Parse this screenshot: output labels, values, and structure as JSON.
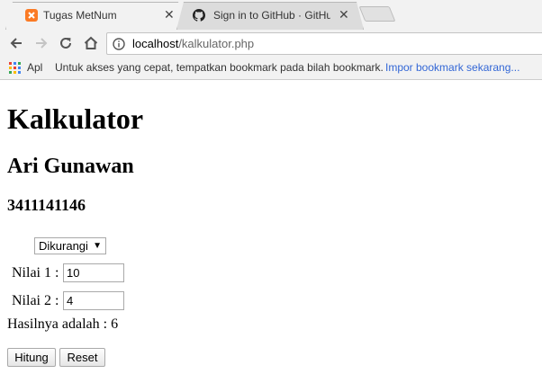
{
  "browser": {
    "tabs": [
      {
        "title": "Tugas MetNum",
        "icon": "xampp-favicon-icon",
        "active": true
      },
      {
        "title": "Sign in to GitHub · GitHu",
        "icon": "github-icon",
        "active": false
      }
    ],
    "tab_close_glyph": "✕",
    "address": {
      "host": "localhost",
      "path": "/kalkulator.php"
    },
    "bookmarks_bar": {
      "apps_label": "Apl",
      "hint": "Untuk akses yang cepat, tempatkan bookmark pada bilah bookmark.",
      "import_link": "Impor bookmark sekarang..."
    }
  },
  "page": {
    "title": "Kalkulator",
    "author": "Ari Gunawan",
    "student_id": "3411141146",
    "operation": {
      "selected": "Dikurangi",
      "arrow": "▼"
    },
    "value1": {
      "label": "Nilai 1 :",
      "value": "10"
    },
    "value2": {
      "label": "Nilai 2 :",
      "value": "4"
    },
    "result_text": "Hasilnya adalah : 6",
    "buttons": {
      "calculate": "Hitung",
      "reset": "Reset"
    }
  },
  "colors": {
    "chrome_bg": "#f2f2f2",
    "link_blue": "#3367d6",
    "xampp_orange": "#fb7a24"
  }
}
